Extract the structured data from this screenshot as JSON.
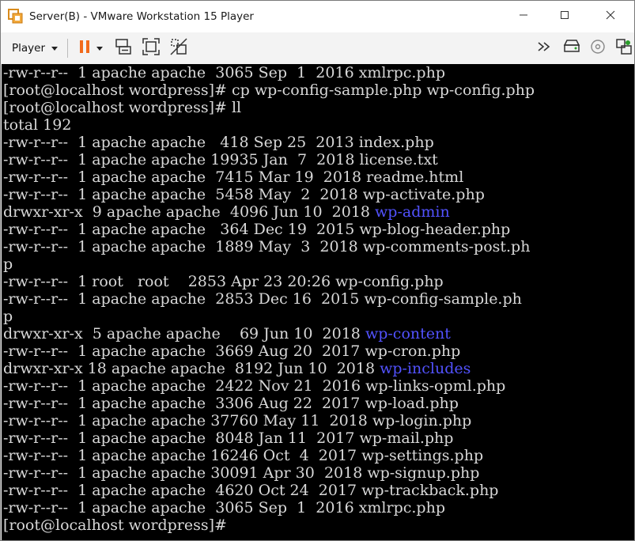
{
  "window": {
    "title": "Server(B) - VMware Workstation 15 Player",
    "minimize_glyph": "—",
    "maximize_glyph": "☐",
    "close_glyph": "✕"
  },
  "toolbar": {
    "player_label": "Player",
    "icons": [
      "pause-icon",
      "send-ctrl-alt-del-icon",
      "fit-guest-icon",
      "unity-icon",
      "fast-forward-icon",
      "removable-devices-icon",
      "cd-icon",
      "settings-icon"
    ]
  },
  "colors": {
    "terminal_bg": "#000000",
    "terminal_fg": "#d8d8d8",
    "directory": "#5252ff",
    "pause_accent": "#f26a1b"
  },
  "terminal": {
    "lines": [
      [
        {
          "t": "-rw-r--r--  1 apache apache  3065 Sep  1  2016 xmlrpc.php",
          "c": "n"
        }
      ],
      [
        {
          "t": "[root@localhost wordpress]# cp wp-config-sample.php wp-config.php",
          "c": "n"
        }
      ],
      [
        {
          "t": "[root@localhost wordpress]# ll",
          "c": "n"
        }
      ],
      [
        {
          "t": "total 192",
          "c": "n"
        }
      ],
      [
        {
          "t": "-rw-r--r--  1 apache apache   418 Sep 25  2013 index.php",
          "c": "n"
        }
      ],
      [
        {
          "t": "-rw-r--r--  1 apache apache 19935 Jan  7  2018 license.txt",
          "c": "n"
        }
      ],
      [
        {
          "t": "-rw-r--r--  1 apache apache  7415 Mar 19  2018 readme.html",
          "c": "n"
        }
      ],
      [
        {
          "t": "-rw-r--r--  1 apache apache  5458 May  2  2018 wp-activate.php",
          "c": "n"
        }
      ],
      [
        {
          "t": "drwxr-xr-x  9 apache apache  4096 Jun 10  2018 ",
          "c": "n"
        },
        {
          "t": "wp-admin",
          "c": "d"
        }
      ],
      [
        {
          "t": "-rw-r--r--  1 apache apache   364 Dec 19  2015 wp-blog-header.php",
          "c": "n"
        }
      ],
      [
        {
          "t": "-rw-r--r--  1 apache apache  1889 May  3  2018 wp-comments-post.ph",
          "c": "n"
        }
      ],
      [
        {
          "t": "p",
          "c": "n"
        }
      ],
      [
        {
          "t": "-rw-r--r--  1 root   root    2853 Apr 23 20:26 wp-config.php",
          "c": "n"
        }
      ],
      [
        {
          "t": "-rw-r--r--  1 apache apache  2853 Dec 16  2015 wp-config-sample.ph",
          "c": "n"
        }
      ],
      [
        {
          "t": "p",
          "c": "n"
        }
      ],
      [
        {
          "t": "drwxr-xr-x  5 apache apache    69 Jun 10  2018 ",
          "c": "n"
        },
        {
          "t": "wp-content",
          "c": "d"
        }
      ],
      [
        {
          "t": "-rw-r--r--  1 apache apache  3669 Aug 20  2017 wp-cron.php",
          "c": "n"
        }
      ],
      [
        {
          "t": "drwxr-xr-x 18 apache apache  8192 Jun 10  2018 ",
          "c": "n"
        },
        {
          "t": "wp-includes",
          "c": "d"
        }
      ],
      [
        {
          "t": "-rw-r--r--  1 apache apache  2422 Nov 21  2016 wp-links-opml.php",
          "c": "n"
        }
      ],
      [
        {
          "t": "-rw-r--r--  1 apache apache  3306 Aug 22  2017 wp-load.php",
          "c": "n"
        }
      ],
      [
        {
          "t": "-rw-r--r--  1 apache apache 37760 May 11  2018 wp-login.php",
          "c": "n"
        }
      ],
      [
        {
          "t": "-rw-r--r--  1 apache apache  8048 Jan 11  2017 wp-mail.php",
          "c": "n"
        }
      ],
      [
        {
          "t": "-rw-r--r--  1 apache apache 16246 Oct  4  2017 wp-settings.php",
          "c": "n"
        }
      ],
      [
        {
          "t": "-rw-r--r--  1 apache apache 30091 Apr 30  2018 wp-signup.php",
          "c": "n"
        }
      ],
      [
        {
          "t": "-rw-r--r--  1 apache apache  4620 Oct 24  2017 wp-trackback.php",
          "c": "n"
        }
      ],
      [
        {
          "t": "-rw-r--r--  1 apache apache  3065 Sep  1  2016 xmlrpc.php",
          "c": "n"
        }
      ],
      [
        {
          "t": "[root@localhost wordpress]#",
          "c": "n"
        }
      ]
    ]
  }
}
